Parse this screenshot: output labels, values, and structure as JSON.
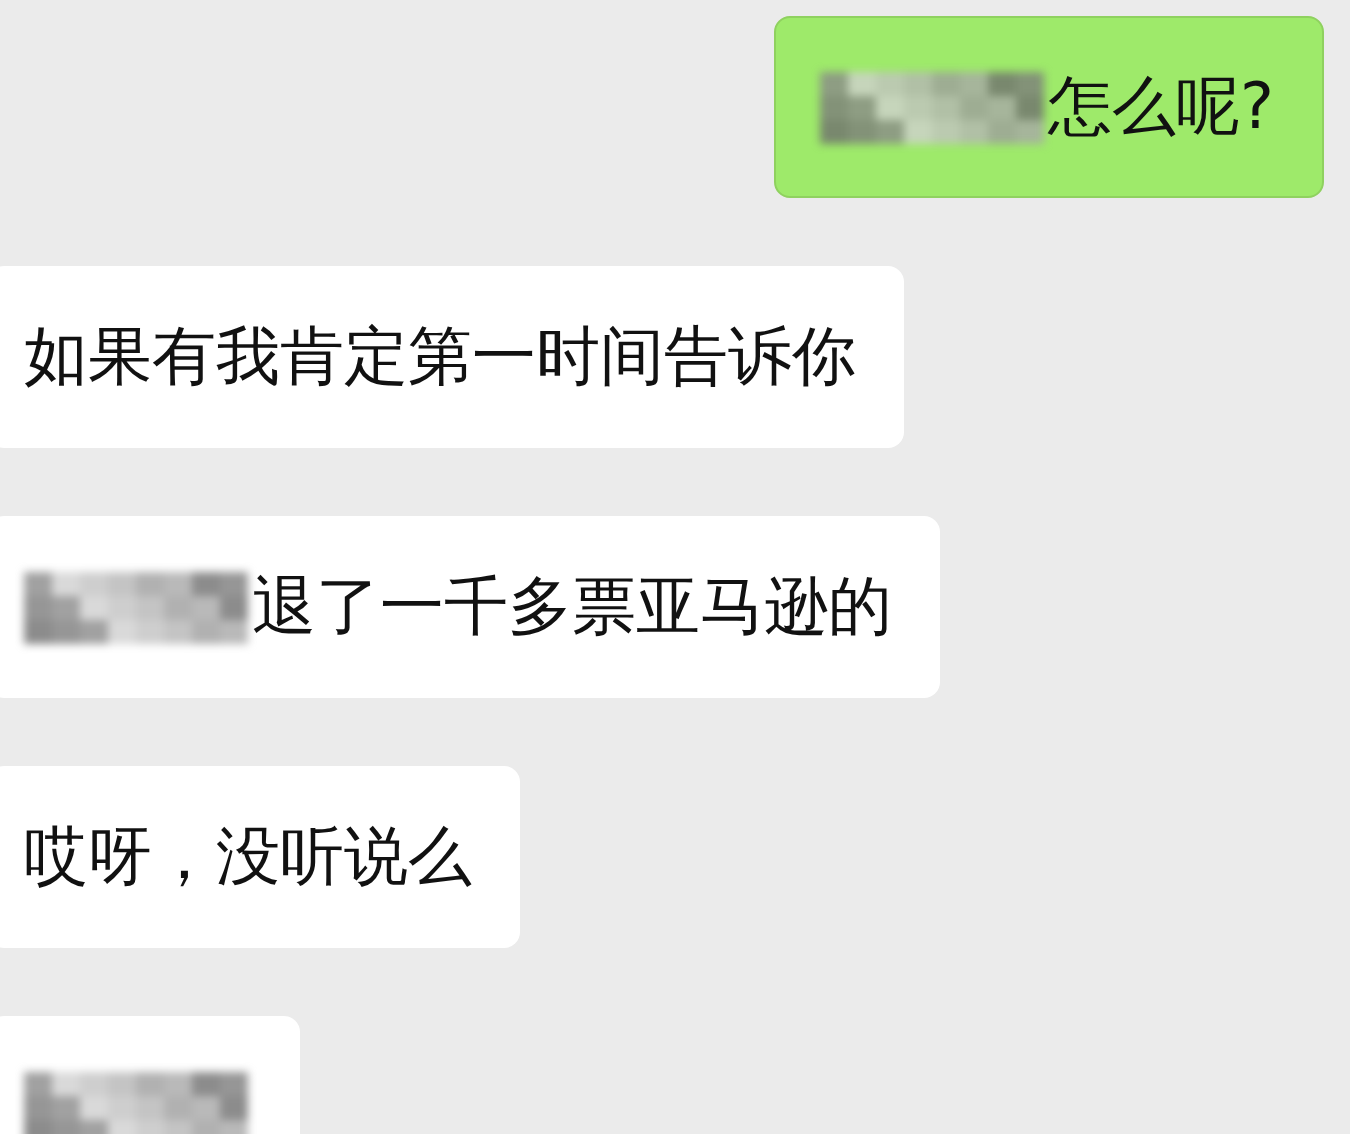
{
  "messages": [
    {
      "outgoing": true,
      "parts": [
        {
          "kind": "redacted"
        },
        {
          "kind": "text",
          "text": "怎么呢?"
        }
      ]
    },
    {
      "outgoing": false,
      "parts": [
        {
          "kind": "text",
          "text": "如果有我肯定第一时间告诉你"
        }
      ]
    },
    {
      "outgoing": false,
      "parts": [
        {
          "kind": "redacted"
        },
        {
          "kind": "text",
          "text": "退了一千多票亚马逊的"
        }
      ]
    },
    {
      "outgoing": false,
      "parts": [
        {
          "kind": "text",
          "text": "哎呀，没听说么"
        }
      ]
    },
    {
      "outgoing": false,
      "parts": [
        {
          "kind": "redacted"
        }
      ]
    }
  ]
}
